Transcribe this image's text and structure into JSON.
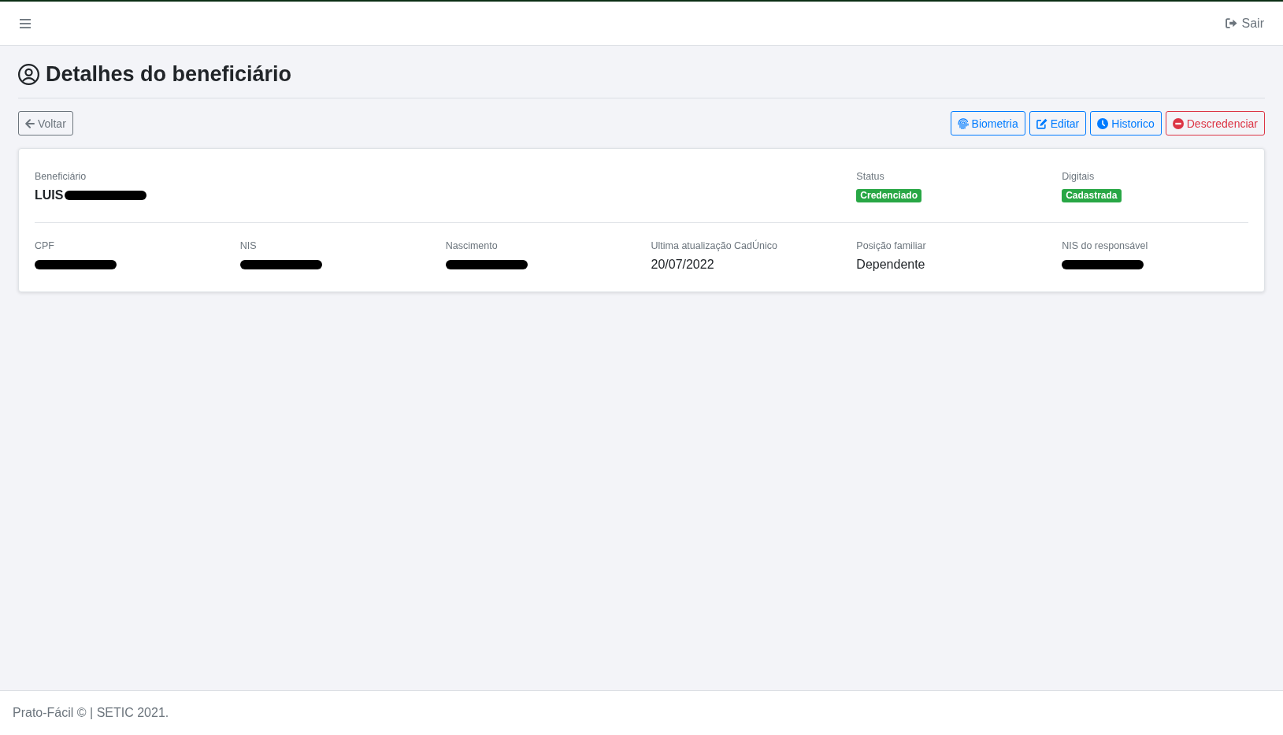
{
  "navbar": {
    "logout": {
      "label": "Sair"
    }
  },
  "page": {
    "title": "Detalhes do beneficiário"
  },
  "toolbar": {
    "back_button": {
      "label": "Voltar"
    },
    "actions": [
      {
        "label": "Biometria",
        "kind": "biometrics",
        "color": "#007bff"
      },
      {
        "label": "Editar",
        "kind": "edit",
        "color": "#007bff"
      },
      {
        "label": "Historico",
        "kind": "history",
        "color": "#007bff"
      },
      {
        "label": "Descredenciar",
        "kind": "revoke",
        "color": "#dc3545"
      }
    ]
  },
  "details": {
    "sections": [
      {
        "fields": [
          {
            "label": "Beneficiário",
            "kind": "name",
            "value": "LUIS",
            "redacted": true
          },
          {
            "label": "Status",
            "kind": "badge",
            "value": "Credenciado",
            "redacted": false
          },
          {
            "label": "Digitais",
            "kind": "badge",
            "value": "Cadastrada",
            "redacted": false
          }
        ]
      },
      {
        "fields": [
          {
            "label": "CPF",
            "kind": "text",
            "redacted": true
          },
          {
            "label": "NIS",
            "kind": "text",
            "redacted": true
          },
          {
            "label": "Nascimento",
            "kind": "text",
            "redacted": true
          },
          {
            "label": "Ultima atualização CadÚnico",
            "kind": "text",
            "value": "20/07/2022",
            "redacted": false
          },
          {
            "label": "Posição familiar",
            "kind": "text",
            "value": "Dependente",
            "redacted": false
          },
          {
            "label": "NIS do responsável",
            "kind": "text",
            "redacted": true
          }
        ]
      }
    ]
  },
  "footer": {
    "text": "Prato-Fácil © | SETIC 2021."
  }
}
